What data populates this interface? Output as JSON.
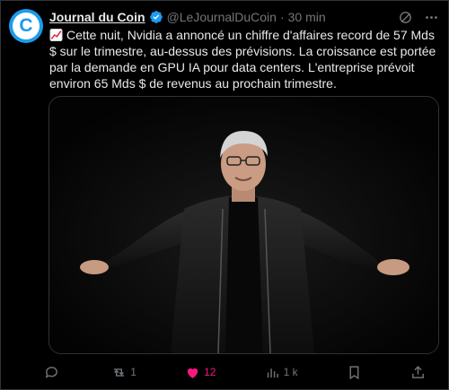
{
  "author": {
    "avatar_letter": "C",
    "name": "Journal du Coin",
    "handle": "@LeJournalDuCoin",
    "separator": "·",
    "time": "30 min"
  },
  "tweet": {
    "emoji_icon": "chart-increasing-icon",
    "text": "Cette nuit, Nvidia a annoncé un chiffre d'affaires record de 57 Mds $ sur le trimestre, au-dessus des prévisions. La croissance est portée par la demande en GPU IA pour data centers. L'entreprise prévoit environ 65 Mds $ de revenus au prochain trimestre."
  },
  "actions": {
    "reply_count": "",
    "retweet_count": "1",
    "like_count": "12",
    "views_count": "1 k"
  },
  "colors": {
    "accent": "#1d9bf0",
    "like": "#f91880",
    "muted": "#71767b"
  }
}
